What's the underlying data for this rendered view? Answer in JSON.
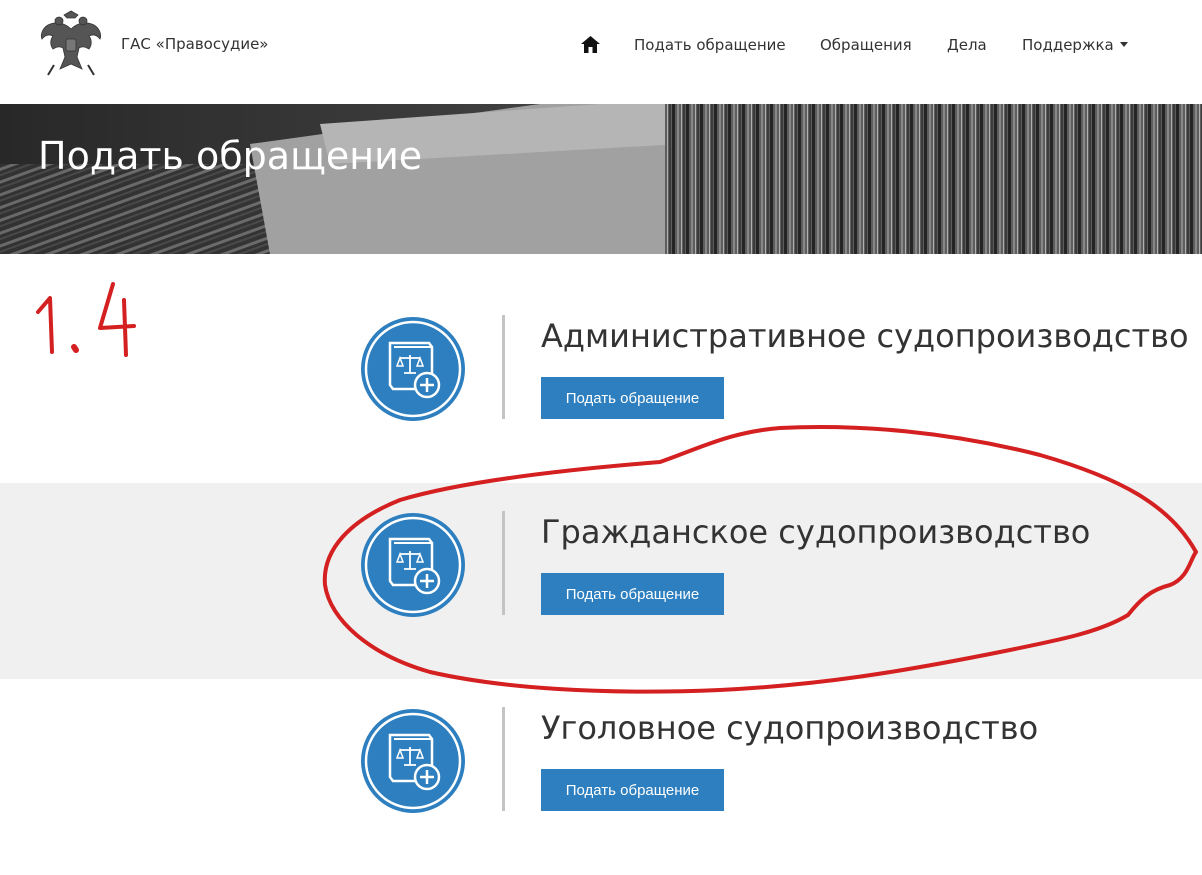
{
  "header": {
    "brand": "ГАС «Правосудие»",
    "logo_icon": "russian-coat-of-arms-icon",
    "nav": {
      "home_icon": "home-icon",
      "items": [
        {
          "label": "Подать обращение"
        },
        {
          "label": "Обращения"
        },
        {
          "label": "Дела"
        },
        {
          "label": "Поддержка",
          "has_dropdown": true
        }
      ]
    }
  },
  "banner": {
    "title": "Подать обращение"
  },
  "sections": [
    {
      "title": "Административное судопроизводство",
      "button_label": "Подать обращение",
      "icon": "law-book-add-icon"
    },
    {
      "title": "Гражданское судопроизводство",
      "button_label": "Подать обращение",
      "icon": "law-book-add-icon"
    },
    {
      "title": "Уголовное судопроизводство",
      "button_label": "Подать обращение",
      "icon": "law-book-add-icon"
    }
  ],
  "annotation": {
    "label": "1.4",
    "color": "#d42020"
  },
  "colors": {
    "accent": "#2e7fbf",
    "section_alt_bg": "#f0f0f0",
    "annotation": "#d42020"
  }
}
